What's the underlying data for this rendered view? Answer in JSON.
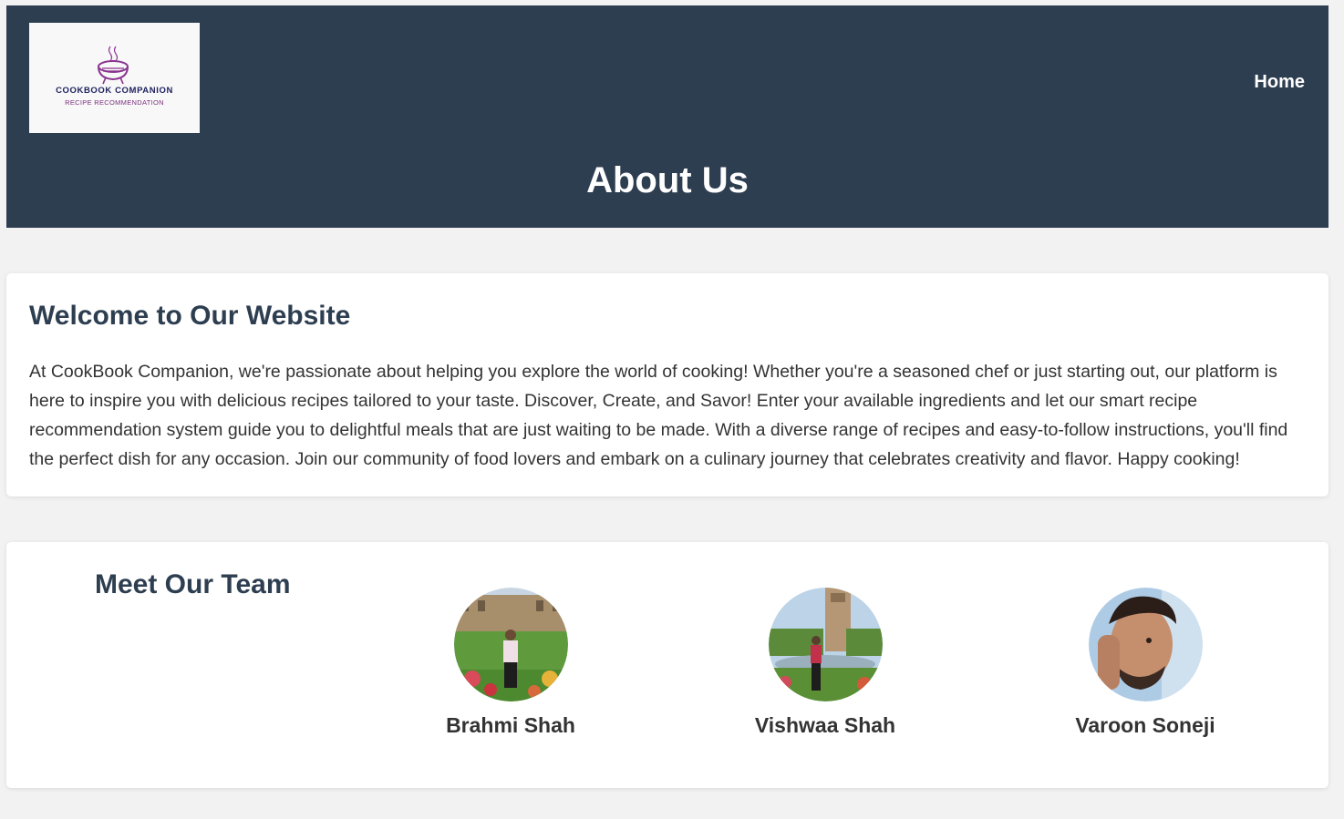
{
  "header": {
    "logo": {
      "title": "COOKBOOK COMPANION",
      "subtitle": "RECIPE RECOMMENDATION",
      "icon": "cooking-pot-icon"
    },
    "nav": {
      "home_label": "Home"
    },
    "page_title": "About Us"
  },
  "welcome": {
    "title": "Welcome to Our Website",
    "body": "At CookBook Companion, we're passionate about helping you explore the world of cooking! Whether you're a seasoned chef or just starting out, our platform is here to inspire you with delicious recipes tailored to your taste. Discover, Create, and Savor! Enter your available ingredients and let our smart recipe recommendation system guide you to delightful meals that are just waiting to be made. With a diverse range of recipes and easy-to-follow instructions, you'll find the perfect dish for any occasion. Join our community of food lovers and embark on a culinary journey that celebrates creativity and flavor. Happy cooking!"
  },
  "team": {
    "title": "Meet Our Team",
    "members": [
      {
        "name": "Brahmi Shah"
      },
      {
        "name": "Vishwaa Shah"
      },
      {
        "name": "Varoon Soneji"
      }
    ]
  },
  "colors": {
    "header_bg": "#2e3e51",
    "page_bg": "#f2f2f2",
    "heading": "#2e3e51",
    "logo_accent": "#7a2e7e"
  }
}
